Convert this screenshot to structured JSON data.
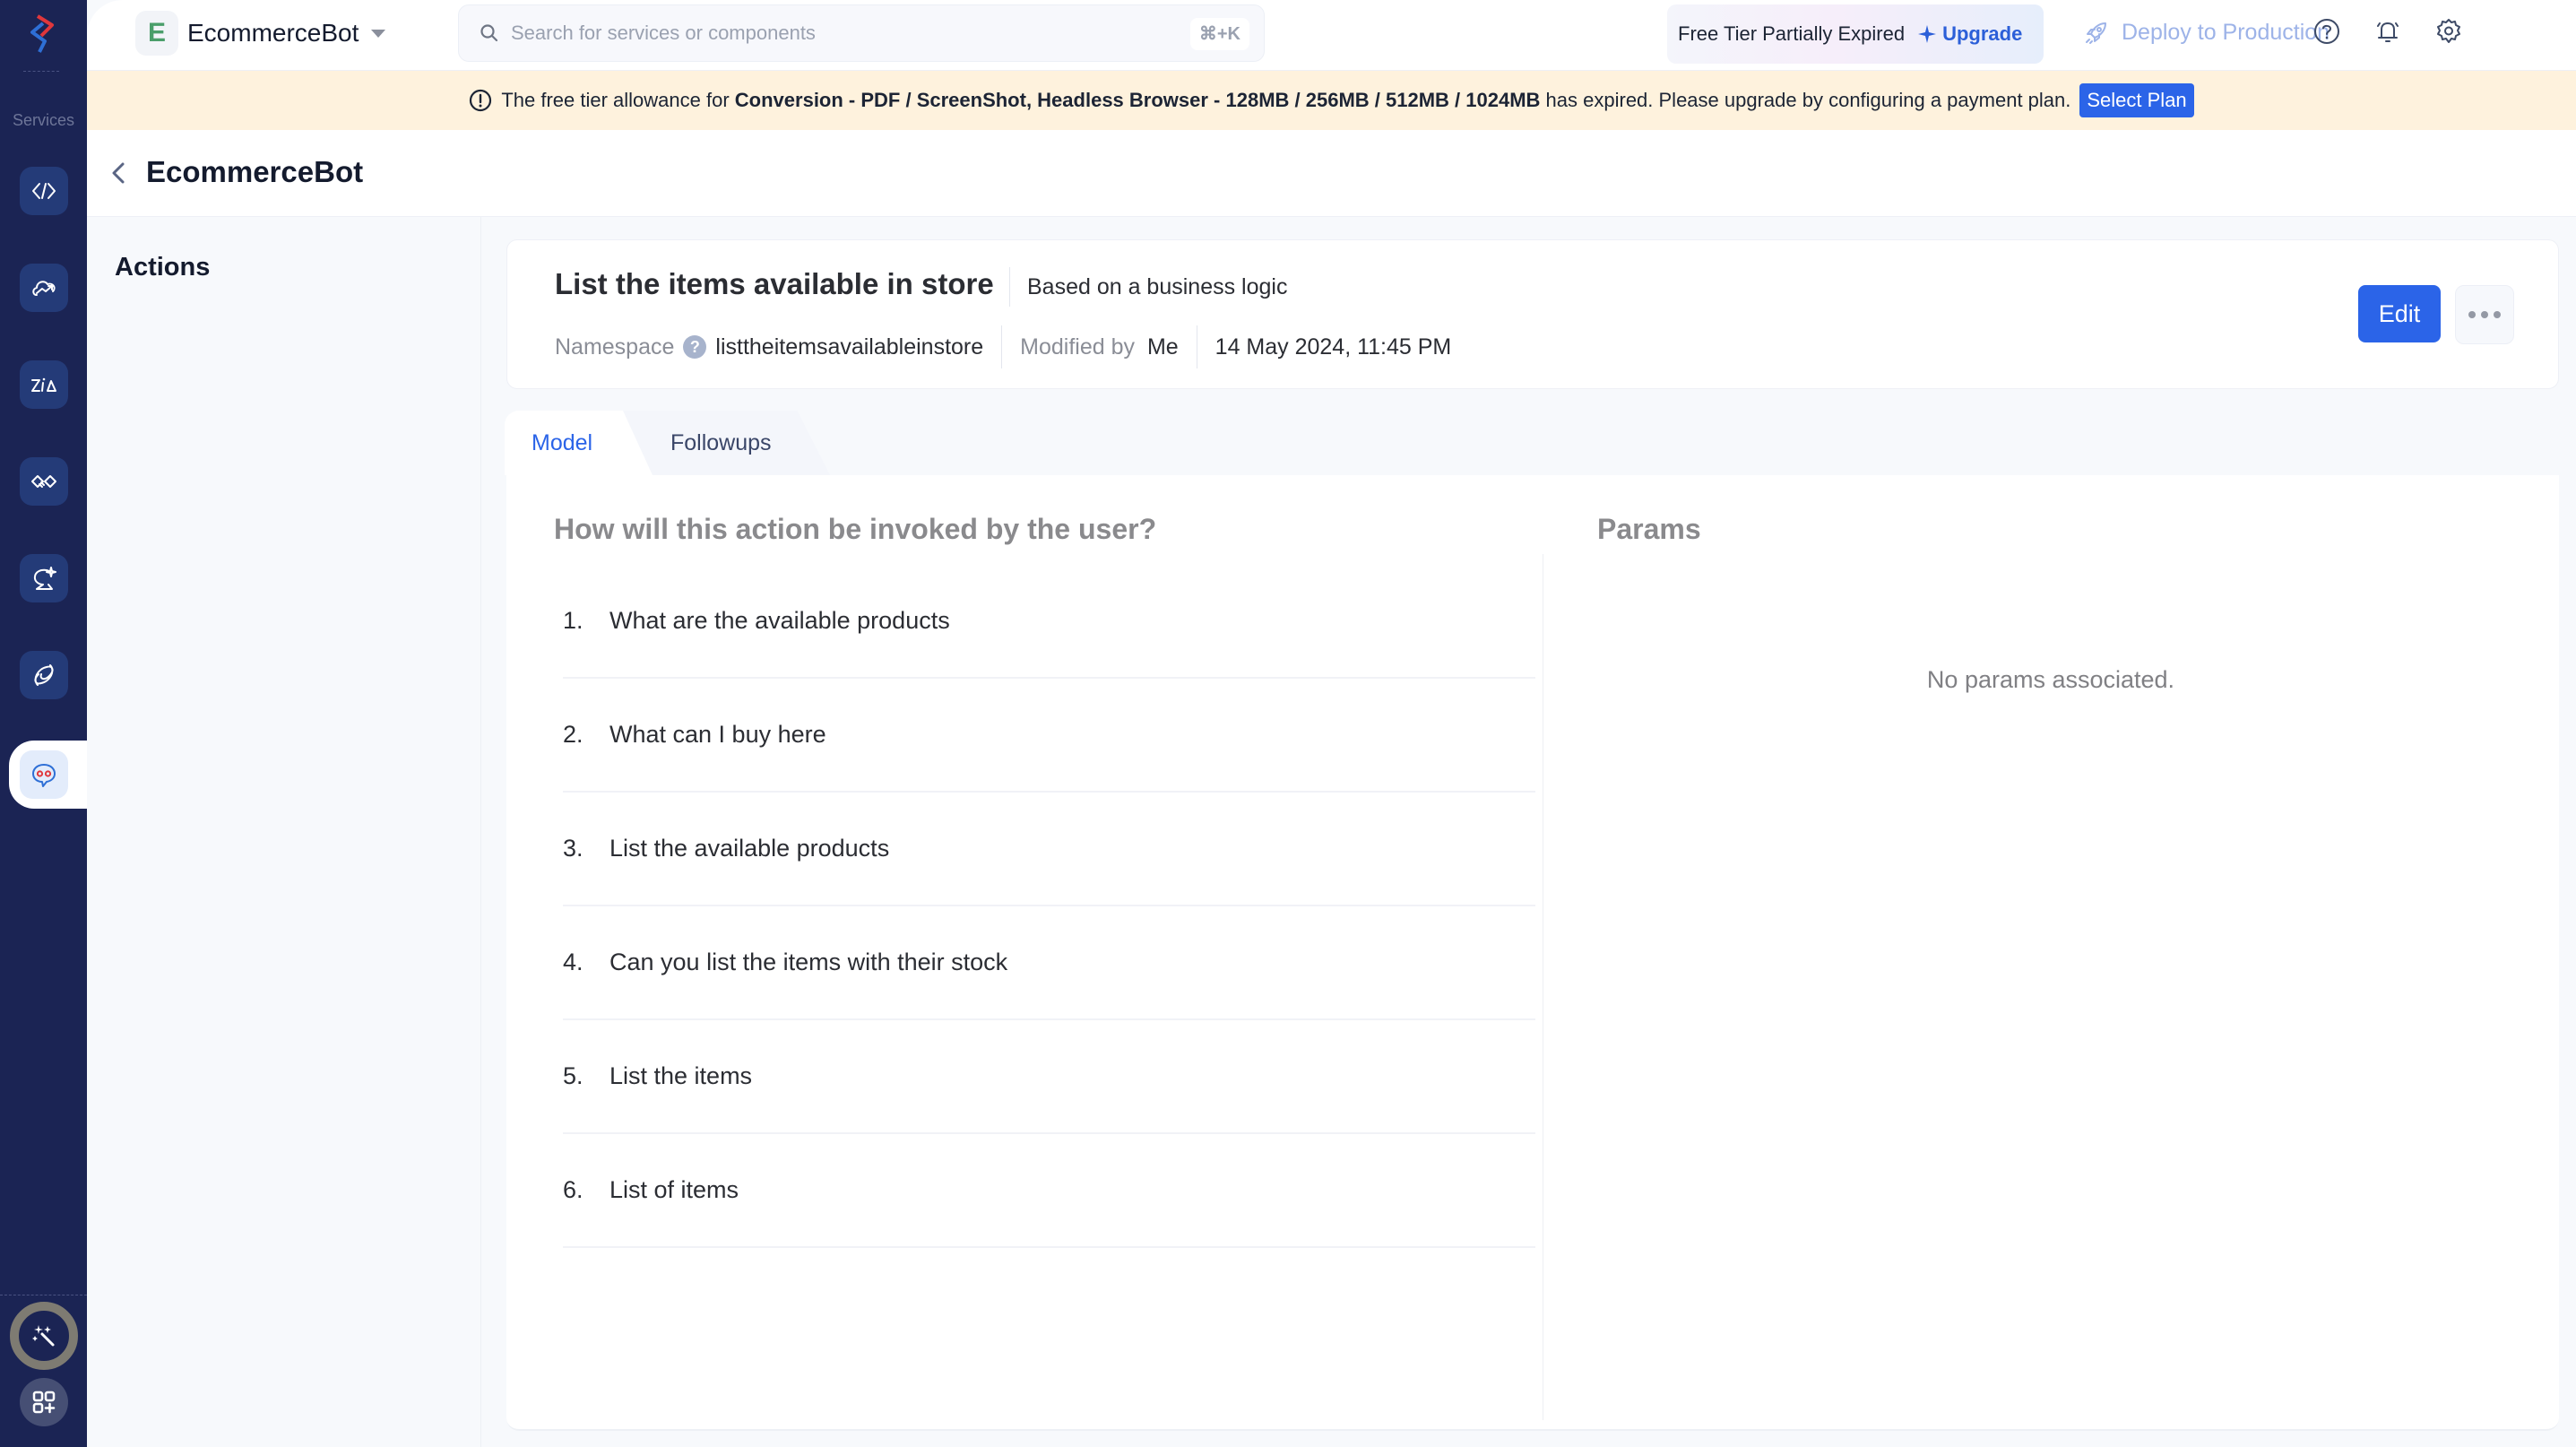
{
  "rail": {
    "services_label": "Services",
    "items": [
      {
        "name": "api-gateway"
      },
      {
        "name": "cloud-analytics"
      },
      {
        "name": "zia"
      },
      {
        "name": "integrations"
      },
      {
        "name": "smart-chat"
      },
      {
        "name": "connections"
      },
      {
        "name": "chatbot",
        "active": true
      }
    ]
  },
  "topbar": {
    "workspace_initial": "E",
    "workspace_name": "EcommerceBot",
    "search_placeholder": "Search for services or components",
    "search_value": "",
    "search_shortcut": "⌘+K",
    "tier_status": "Free Tier Partially Expired",
    "upgrade_label": "Upgrade",
    "deploy_label": "Deploy to Production"
  },
  "banner": {
    "prefix": "The free tier allowance for",
    "resource": "Conversion - PDF / ScreenShot, Headless Browser - 128MB / 256MB / 512MB / 1024MB",
    "suffix": "has expired. Please upgrade by configuring a payment plan.",
    "button_label": "Select Plan"
  },
  "page": {
    "title": "EcommerceBot",
    "left_panel_title": "Actions"
  },
  "action": {
    "title": "List the items available in store",
    "type": "Based on a business logic",
    "namespace_label": "Namespace",
    "namespace_help": "?",
    "namespace_value": "listtheitemsavailableinstore",
    "modified_by_label": "Modified by",
    "modified_by_value": "Me",
    "modified_time": "14 May 2024, 11:45 PM",
    "edit_label": "Edit"
  },
  "tabs": [
    {
      "label": "Model",
      "active": true
    },
    {
      "label": "Followups",
      "active": false
    }
  ],
  "model": {
    "utterances_heading": "How will this action be invoked by the user?",
    "utterances": [
      {
        "num": "1.",
        "text": "What are the available products"
      },
      {
        "num": "2.",
        "text": "What can I buy here"
      },
      {
        "num": "3.",
        "text": "List the available products"
      },
      {
        "num": "4.",
        "text": "Can you list the items with their stock"
      },
      {
        "num": "5.",
        "text": "List the items"
      },
      {
        "num": "6.",
        "text": "List of items"
      }
    ],
    "params_heading": "Params",
    "params_empty": "No params associated."
  },
  "colors": {
    "rail_bg": "#1b2454",
    "accent": "#2b64e8",
    "banner_bg": "#fef2dd"
  }
}
